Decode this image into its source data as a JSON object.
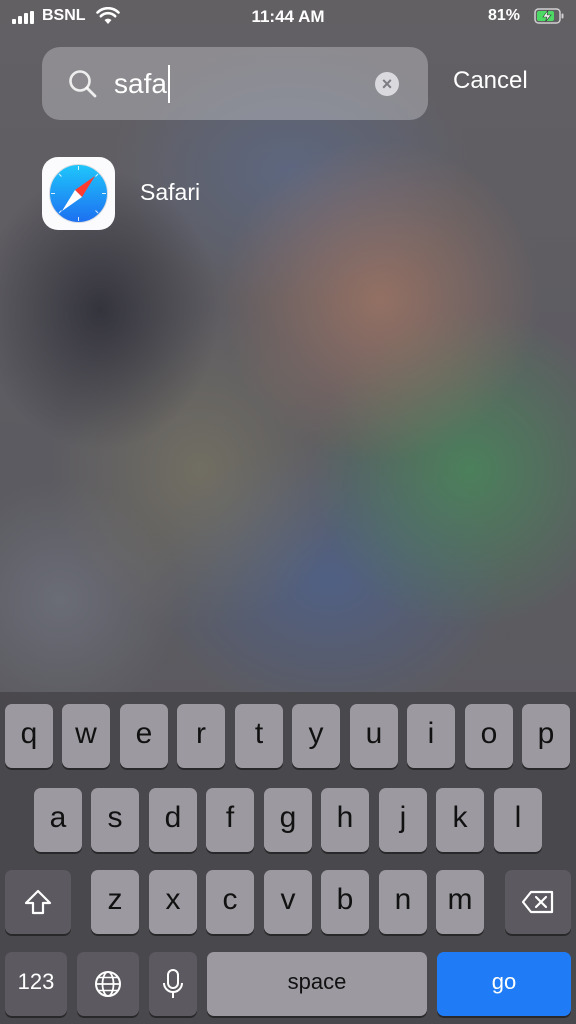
{
  "status_bar": {
    "carrier": "BSNL",
    "time": "11:44 AM",
    "battery_percent": "81%"
  },
  "search": {
    "query": "safa",
    "cancel_label": "Cancel"
  },
  "results": [
    {
      "name": "Safari",
      "icon": "safari-compass-icon"
    }
  ],
  "keyboard": {
    "row1": [
      "q",
      "w",
      "e",
      "r",
      "t",
      "y",
      "u",
      "i",
      "o",
      "p"
    ],
    "row2": [
      "a",
      "s",
      "d",
      "f",
      "g",
      "h",
      "j",
      "k",
      "l"
    ],
    "row3": [
      "z",
      "x",
      "c",
      "v",
      "b",
      "n",
      "m"
    ],
    "numbers_label": "123",
    "space_label": "space",
    "go_label": "go",
    "accent": "#1f7cf6"
  }
}
